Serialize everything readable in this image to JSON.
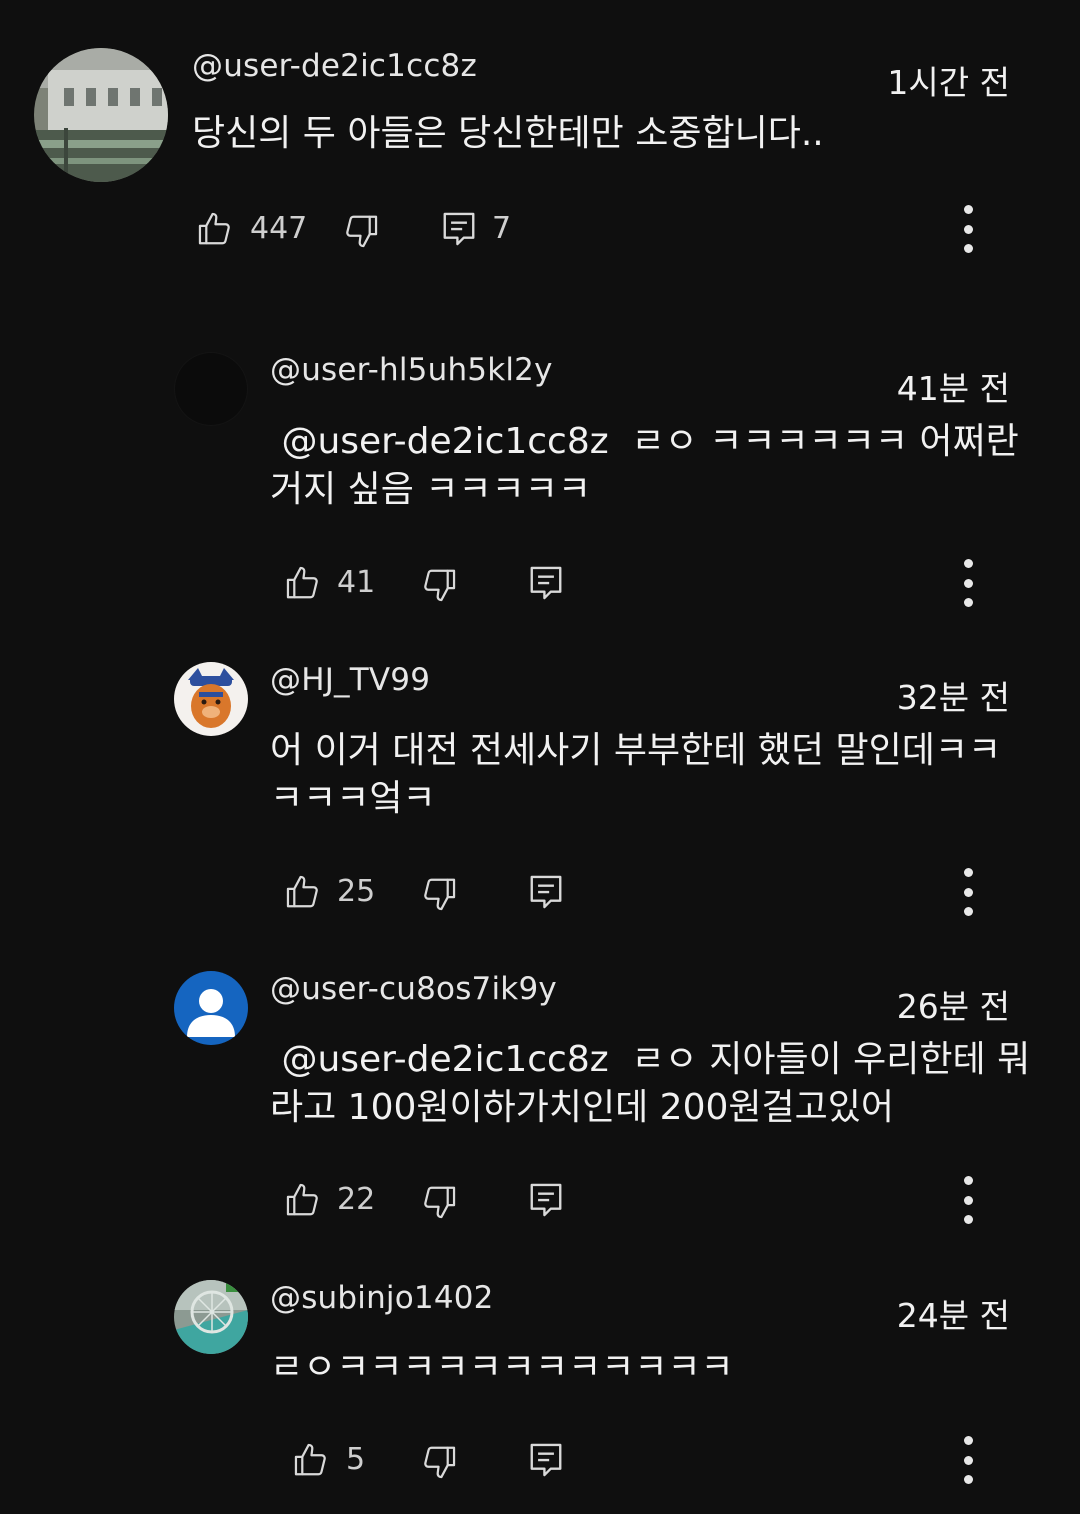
{
  "comments": [
    {
      "author": "@user-de2ic1cc8z",
      "time": "1시간 전",
      "body": "당신의 두 아들은 당신한테만 소중합니다..",
      "likes": "447",
      "replies": "7",
      "avatar_icon": "photo-avatar-building"
    },
    {
      "author": "@user-hl5uh5kl2y",
      "time": "41분 전",
      "body": " @user-de2ic1cc8z  ㄹㅇ ㅋㅋㅋㅋㅋㅋ 어쩌란\n거지 싶음 ㅋㅋㅋㅋㅋ",
      "likes": "41",
      "avatar_icon": "dark-avatar"
    },
    {
      "author": "@HJ_TV99",
      "time": "32분 전",
      "body": "어 이거 대전 전세사기 부부한테 했던 말인데ㅋㅋ\nㅋㅋㅋ엌ㅋ",
      "likes": "25",
      "avatar_icon": "bear-character-avatar"
    },
    {
      "author": "@user-cu8os7ik9y",
      "time": "26분 전",
      "body": " @user-de2ic1cc8z  ㄹㅇ 지아들이 우리한테 뭐\n라고 100원이하가치인데 200원걸고있어",
      "likes": "22",
      "avatar_icon": "default-person-avatar"
    },
    {
      "author": "@subinjo1402",
      "time": "24분 전",
      "body": "ㄹㅇㅋㅋㅋㅋㅋㅋㅋㅋㅋㅋㅋㅋ",
      "likes": "5",
      "avatar_icon": "photo-avatar-wheel"
    }
  ],
  "colors": {
    "background": "#0f0f0f",
    "text": "#f1f1f1",
    "icon": "#d9d9d9",
    "default_avatar_blue": "#1565c0"
  }
}
